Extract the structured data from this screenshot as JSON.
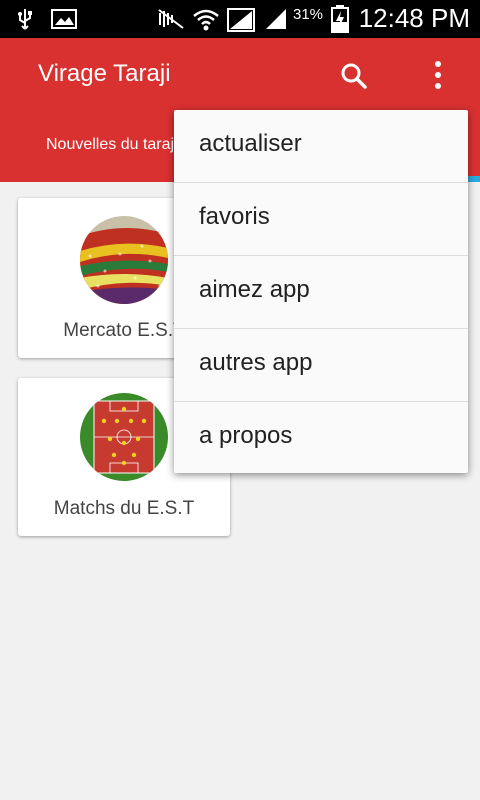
{
  "status_bar": {
    "battery_percent": "31%",
    "time": "12:48 PM"
  },
  "app_bar": {
    "title": "Virage Taraji",
    "tab_label": "Nouvelles du taraji"
  },
  "cards": [
    {
      "label": "Mercato E.S.T"
    },
    {
      "label": "Matchs du E.S.T"
    }
  ],
  "menu": {
    "items": [
      {
        "label": "actualiser"
      },
      {
        "label": "favoris"
      },
      {
        "label": "aimez app"
      },
      {
        "label": "autres app"
      },
      {
        "label": "a propos"
      }
    ]
  },
  "colors": {
    "app_bar": "#d93030",
    "tab_indicator": "#29a9e0"
  },
  "icons": [
    "usb-icon",
    "image-icon",
    "mute-icon",
    "wifi-icon",
    "signal-icon",
    "battery-charging-icon",
    "search-icon",
    "more-vert-icon"
  ]
}
